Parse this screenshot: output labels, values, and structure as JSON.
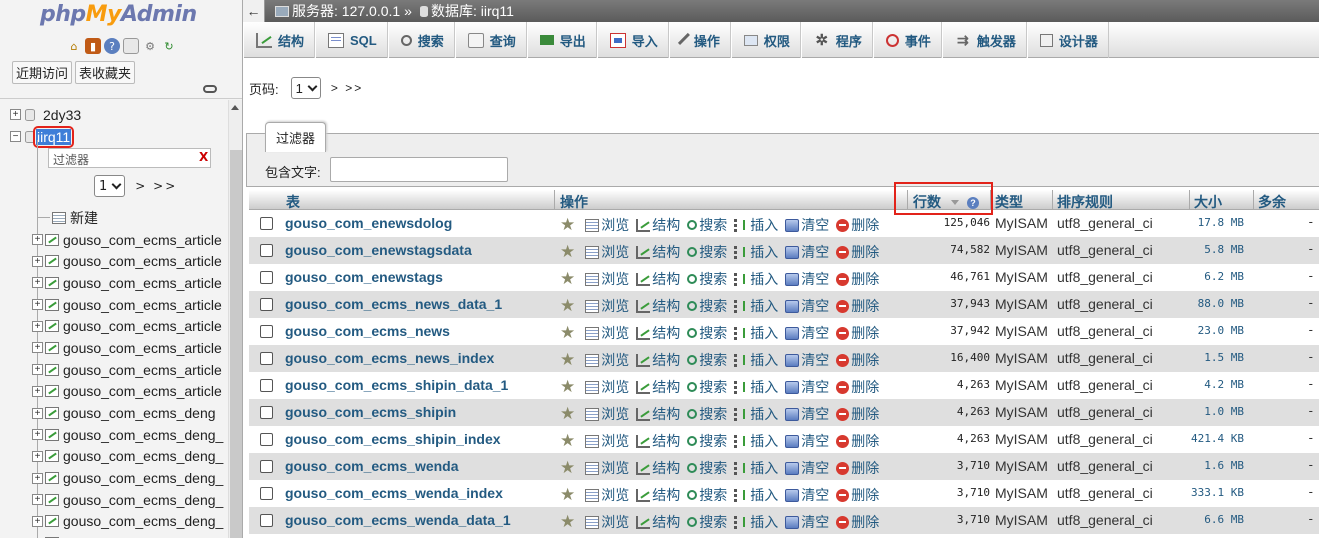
{
  "nav": {
    "logo_php": "php",
    "logo_my": "My",
    "logo_admin": "Admin",
    "tabs": [
      "近期访问",
      "表收藏夹"
    ],
    "tree_items": [
      {
        "label": "2dy33",
        "toggle": "+"
      },
      {
        "label": "iirq11",
        "toggle": "−"
      }
    ],
    "filter_placeholder": "过滤器",
    "filter_clear": "X",
    "page_value": "1",
    "pager_next": "> >>",
    "new_label": "新建",
    "tables": [
      "gouso_com_ecms_article",
      "gouso_com_ecms_article",
      "gouso_com_ecms_article",
      "gouso_com_ecms_article",
      "gouso_com_ecms_article",
      "gouso_com_ecms_article",
      "gouso_com_ecms_article",
      "gouso_com_ecms_article",
      "gouso_com_ecms_deng",
      "gouso_com_ecms_deng_",
      "gouso_com_ecms_deng_",
      "gouso_com_ecms_deng_",
      "gouso_com_ecms_deng_",
      "gouso_com_ecms_deng_",
      "gouso_com_ecms_deng_"
    ]
  },
  "breadcrumb": {
    "back": "←",
    "server": "服务器: 127.0.0.1",
    "sep": "»",
    "database": "数据库: iirq11"
  },
  "menu": [
    {
      "label": "结构",
      "icon": "structure-icon"
    },
    {
      "label": "SQL",
      "icon": "sql-icon"
    },
    {
      "label": "搜索",
      "icon": "search-icon"
    },
    {
      "label": "查询",
      "icon": "query-icon"
    },
    {
      "label": "导出",
      "icon": "export-icon"
    },
    {
      "label": "导入",
      "icon": "import-icon"
    },
    {
      "label": "操作",
      "icon": "operations-icon"
    },
    {
      "label": "权限",
      "icon": "privileges-icon"
    },
    {
      "label": "程序",
      "icon": "routines-icon"
    },
    {
      "label": "事件",
      "icon": "events-icon"
    },
    {
      "label": "触发器",
      "icon": "triggers-icon"
    },
    {
      "label": "设计器",
      "icon": "designer-icon"
    }
  ],
  "pager": {
    "label": "页码:",
    "value": "1",
    "next": "> >>"
  },
  "filter": {
    "legend": "过滤器",
    "label": "包含文字:",
    "value": ""
  },
  "table": {
    "headers": {
      "table": "表",
      "ops": "操作",
      "rows": "行数",
      "type": "类型",
      "collation": "排序规则",
      "size": "大小",
      "overhead": "多余"
    },
    "actions": [
      "浏览",
      "结构",
      "搜索",
      "插入",
      "清空",
      "删除"
    ],
    "rows": [
      {
        "name": "gouso_com_enewsdolog",
        "rows": "125,046",
        "engine": "MyISAM",
        "collation": "utf8_general_ci",
        "size": "17.8 MB",
        "overhead": "-"
      },
      {
        "name": "gouso_com_enewstagsdata",
        "rows": "74,582",
        "engine": "MyISAM",
        "collation": "utf8_general_ci",
        "size": "5.8 MB",
        "overhead": "-"
      },
      {
        "name": "gouso_com_enewstags",
        "rows": "46,761",
        "engine": "MyISAM",
        "collation": "utf8_general_ci",
        "size": "6.2 MB",
        "overhead": "-"
      },
      {
        "name": "gouso_com_ecms_news_data_1",
        "rows": "37,943",
        "engine": "MyISAM",
        "collation": "utf8_general_ci",
        "size": "88.0 MB",
        "overhead": "-"
      },
      {
        "name": "gouso_com_ecms_news",
        "rows": "37,942",
        "engine": "MyISAM",
        "collation": "utf8_general_ci",
        "size": "23.0 MB",
        "overhead": "-"
      },
      {
        "name": "gouso_com_ecms_news_index",
        "rows": "16,400",
        "engine": "MyISAM",
        "collation": "utf8_general_ci",
        "size": "1.5 MB",
        "overhead": "-"
      },
      {
        "name": "gouso_com_ecms_shipin_data_1",
        "rows": "4,263",
        "engine": "MyISAM",
        "collation": "utf8_general_ci",
        "size": "4.2 MB",
        "overhead": "-"
      },
      {
        "name": "gouso_com_ecms_shipin",
        "rows": "4,263",
        "engine": "MyISAM",
        "collation": "utf8_general_ci",
        "size": "1.0 MB",
        "overhead": "-"
      },
      {
        "name": "gouso_com_ecms_shipin_index",
        "rows": "4,263",
        "engine": "MyISAM",
        "collation": "utf8_general_ci",
        "size": "421.4 KB",
        "overhead": "-"
      },
      {
        "name": "gouso_com_ecms_wenda",
        "rows": "3,710",
        "engine": "MyISAM",
        "collation": "utf8_general_ci",
        "size": "1.6 MB",
        "overhead": "-"
      },
      {
        "name": "gouso_com_ecms_wenda_index",
        "rows": "3,710",
        "engine": "MyISAM",
        "collation": "utf8_general_ci",
        "size": "333.1 KB",
        "overhead": "-"
      },
      {
        "name": "gouso_com_ecms_wenda_data_1",
        "rows": "3,710",
        "engine": "MyISAM",
        "collation": "utf8_general_ci",
        "size": "6.6 MB",
        "overhead": "-"
      }
    ]
  },
  "colors": {
    "link": "#235a81",
    "highlight": "#e2231a",
    "selected": "#3e7ed8"
  }
}
